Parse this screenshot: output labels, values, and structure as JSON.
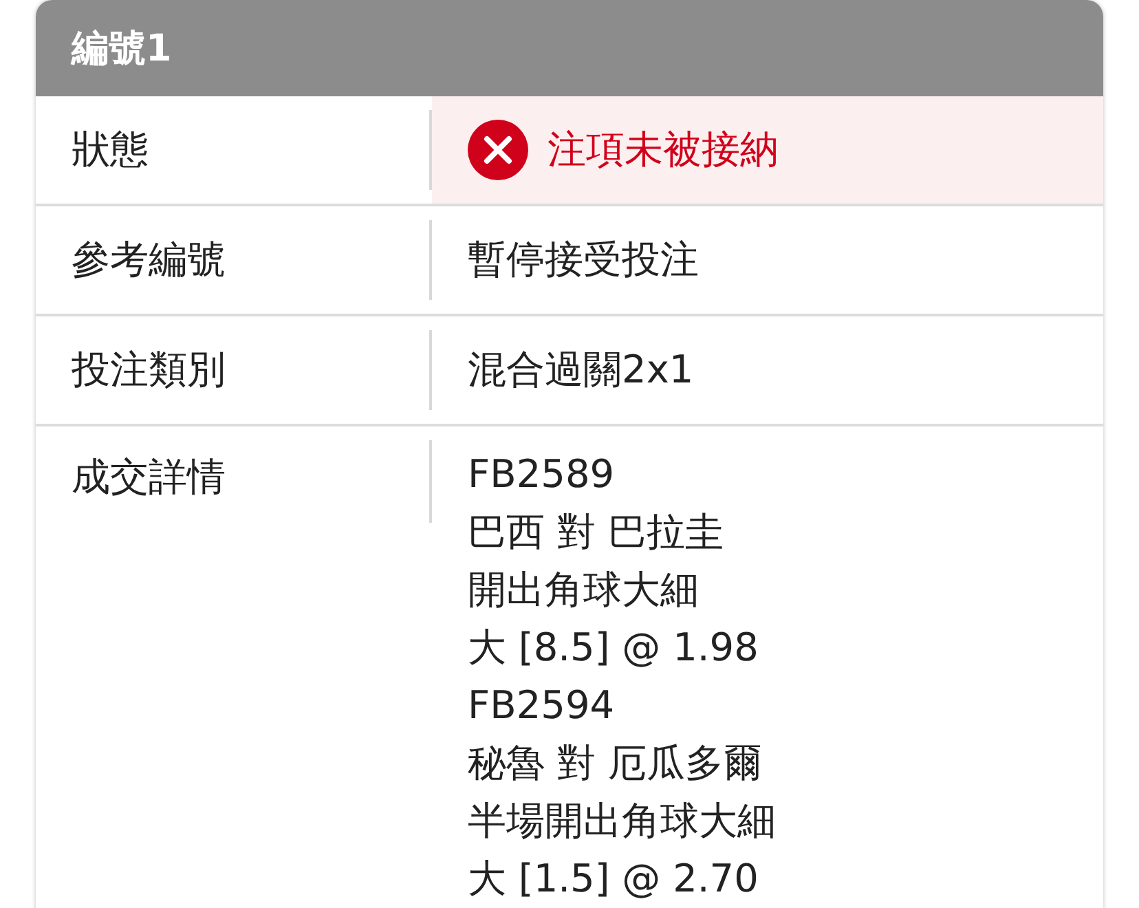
{
  "card": {
    "title": "編號1",
    "rows": [
      {
        "kind": "status",
        "label": "狀態",
        "value": "注項未被接納",
        "rejected": true
      },
      {
        "kind": "text",
        "label": "參考編號",
        "value": "暫停接受投注"
      },
      {
        "kind": "text",
        "label": "投注類別",
        "value": "混合過關2x1"
      },
      {
        "kind": "lines",
        "label": "成交詳情",
        "lines": [
          "FB2589",
          "巴西 對 巴拉圭",
          "開出角球大細",
          "大 [8.5] @ 1.98",
          "FB2594",
          "秘魯 對 厄瓜多爾",
          "半場開出角球大細",
          "大 [1.5] @ 2.70"
        ]
      }
    ]
  }
}
